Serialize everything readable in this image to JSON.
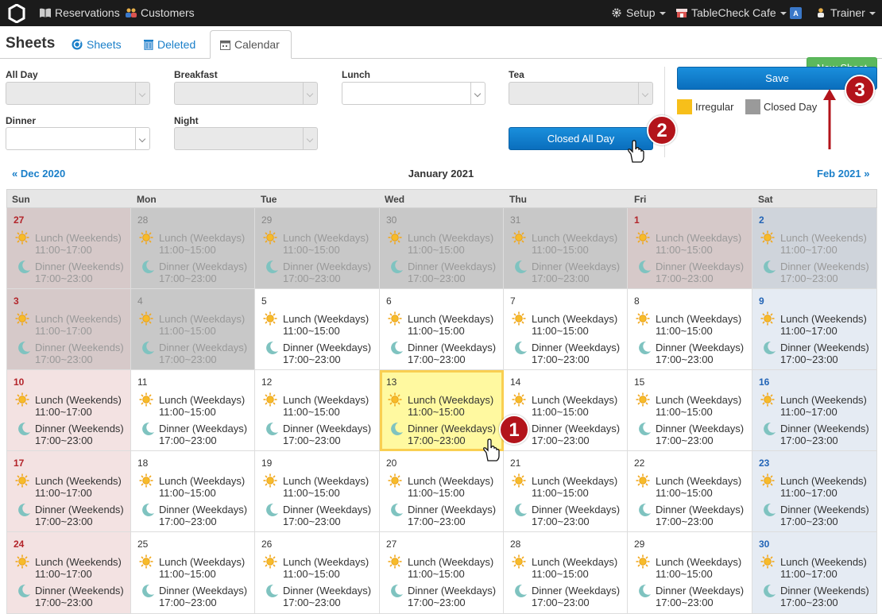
{
  "topnav": {
    "reservations": "Reservations",
    "customers": "Customers",
    "setup": "Setup",
    "store": "TableCheck Cafe",
    "language_icon": "language-icon",
    "user": "Trainer"
  },
  "subnav": {
    "title": "Sheets",
    "tabs": [
      "Sheets",
      "Deleted",
      "Calendar"
    ],
    "active_tab": "Calendar",
    "new_sheet": "New Sheet"
  },
  "filters": {
    "all_day": "All Day",
    "breakfast": "Breakfast",
    "lunch": "Lunch",
    "tea": "Tea",
    "dinner": "Dinner",
    "night": "Night"
  },
  "buttons": {
    "closed_all_day": "Closed All Day",
    "save": "Save"
  },
  "legend": {
    "irregular": "Irregular",
    "closed_day": "Closed Day"
  },
  "colors": {
    "irregular": "#f7bf1a",
    "closed_day": "#9a9a9a",
    "accent": "#1a7fc9",
    "badge": "#b3141b",
    "selected": "#fff9a0"
  },
  "badges": [
    "1",
    "2",
    "3"
  ],
  "calendar": {
    "prev": "« Dec 2020",
    "month": "January 2021",
    "next": "Feb 2021 »",
    "weekdays": [
      "Sun",
      "Mon",
      "Tue",
      "Wed",
      "Thu",
      "Fri",
      "Sat"
    ],
    "selected_day": "13",
    "weeks": [
      [
        {
          "day": "27",
          "closed": true,
          "lunch": "Lunch (Weekends)",
          "lunch_time": "11:00~17:00",
          "dinner": "Dinner (Weekends)",
          "dinner_time": "17:00~23:00"
        },
        {
          "day": "28",
          "closed": true,
          "lunch": "Lunch (Weekdays)",
          "lunch_time": "11:00~15:00",
          "dinner": "Dinner (Weekdays)",
          "dinner_time": "17:00~23:00"
        },
        {
          "day": "29",
          "closed": true,
          "lunch": "Lunch (Weekdays)",
          "lunch_time": "11:00~15:00",
          "dinner": "Dinner (Weekdays)",
          "dinner_time": "17:00~23:00"
        },
        {
          "day": "30",
          "closed": true,
          "lunch": "Lunch (Weekdays)",
          "lunch_time": "11:00~15:00",
          "dinner": "Dinner (Weekdays)",
          "dinner_time": "17:00~23:00"
        },
        {
          "day": "31",
          "closed": true,
          "lunch": "Lunch (Weekdays)",
          "lunch_time": "11:00~15:00",
          "dinner": "Dinner (Weekdays)",
          "dinner_time": "17:00~23:00"
        },
        {
          "day": "1",
          "closed": true,
          "lunch": "Lunch (Weekdays)",
          "lunch_time": "11:00~15:00",
          "dinner": "Dinner (Weekdays)",
          "dinner_time": "17:00~23:00"
        },
        {
          "day": "2",
          "closed": true,
          "lunch": "Lunch (Weekends)",
          "lunch_time": "11:00~17:00",
          "dinner": "Dinner (Weekends)",
          "dinner_time": "17:00~23:00"
        }
      ],
      [
        {
          "day": "3",
          "closed": true,
          "lunch": "Lunch (Weekends)",
          "lunch_time": "11:00~17:00",
          "dinner": "Dinner (Weekends)",
          "dinner_time": "17:00~23:00"
        },
        {
          "day": "4",
          "closed": true,
          "lunch": "Lunch (Weekdays)",
          "lunch_time": "11:00~15:00",
          "dinner": "Dinner (Weekdays)",
          "dinner_time": "17:00~23:00"
        },
        {
          "day": "5",
          "closed": false,
          "lunch": "Lunch (Weekdays)",
          "lunch_time": "11:00~15:00",
          "dinner": "Dinner (Weekdays)",
          "dinner_time": "17:00~23:00"
        },
        {
          "day": "6",
          "closed": false,
          "lunch": "Lunch (Weekdays)",
          "lunch_time": "11:00~15:00",
          "dinner": "Dinner (Weekdays)",
          "dinner_time": "17:00~23:00"
        },
        {
          "day": "7",
          "closed": false,
          "lunch": "Lunch (Weekdays)",
          "lunch_time": "11:00~15:00",
          "dinner": "Dinner (Weekdays)",
          "dinner_time": "17:00~23:00"
        },
        {
          "day": "8",
          "closed": false,
          "lunch": "Lunch (Weekdays)",
          "lunch_time": "11:00~15:00",
          "dinner": "Dinner (Weekdays)",
          "dinner_time": "17:00~23:00"
        },
        {
          "day": "9",
          "closed": false,
          "lunch": "Lunch (Weekends)",
          "lunch_time": "11:00~17:00",
          "dinner": "Dinner (Weekends)",
          "dinner_time": "17:00~23:00"
        }
      ],
      [
        {
          "day": "10",
          "closed": false,
          "lunch": "Lunch (Weekends)",
          "lunch_time": "11:00~17:00",
          "dinner": "Dinner (Weekends)",
          "dinner_time": "17:00~23:00"
        },
        {
          "day": "11",
          "closed": false,
          "lunch": "Lunch (Weekdays)",
          "lunch_time": "11:00~15:00",
          "dinner": "Dinner (Weekdays)",
          "dinner_time": "17:00~23:00"
        },
        {
          "day": "12",
          "closed": false,
          "lunch": "Lunch (Weekdays)",
          "lunch_time": "11:00~15:00",
          "dinner": "Dinner (Weekdays)",
          "dinner_time": "17:00~23:00"
        },
        {
          "day": "13",
          "closed": false,
          "lunch": "Lunch (Weekdays)",
          "lunch_time": "11:00~15:00",
          "dinner": "Dinner (Weekdays)",
          "dinner_time": "17:00~23:00"
        },
        {
          "day": "14",
          "closed": false,
          "lunch": "Lunch (Weekdays)",
          "lunch_time": "11:00~15:00",
          "dinner": "Dinner (Weekdays)",
          "dinner_time": "17:00~23:00"
        },
        {
          "day": "15",
          "closed": false,
          "lunch": "Lunch (Weekdays)",
          "lunch_time": "11:00~15:00",
          "dinner": "Dinner (Weekdays)",
          "dinner_time": "17:00~23:00"
        },
        {
          "day": "16",
          "closed": false,
          "lunch": "Lunch (Weekends)",
          "lunch_time": "11:00~17:00",
          "dinner": "Dinner (Weekends)",
          "dinner_time": "17:00~23:00"
        }
      ],
      [
        {
          "day": "17",
          "closed": false,
          "lunch": "Lunch (Weekends)",
          "lunch_time": "11:00~17:00",
          "dinner": "Dinner (Weekends)",
          "dinner_time": "17:00~23:00"
        },
        {
          "day": "18",
          "closed": false,
          "lunch": "Lunch (Weekdays)",
          "lunch_time": "11:00~15:00",
          "dinner": "Dinner (Weekdays)",
          "dinner_time": "17:00~23:00"
        },
        {
          "day": "19",
          "closed": false,
          "lunch": "Lunch (Weekdays)",
          "lunch_time": "11:00~15:00",
          "dinner": "Dinner (Weekdays)",
          "dinner_time": "17:00~23:00"
        },
        {
          "day": "20",
          "closed": false,
          "lunch": "Lunch (Weekdays)",
          "lunch_time": "11:00~15:00",
          "dinner": "Dinner (Weekdays)",
          "dinner_time": "17:00~23:00"
        },
        {
          "day": "21",
          "closed": false,
          "lunch": "Lunch (Weekdays)",
          "lunch_time": "11:00~15:00",
          "dinner": "Dinner (Weekdays)",
          "dinner_time": "17:00~23:00"
        },
        {
          "day": "22",
          "closed": false,
          "lunch": "Lunch (Weekdays)",
          "lunch_time": "11:00~15:00",
          "dinner": "Dinner (Weekdays)",
          "dinner_time": "17:00~23:00"
        },
        {
          "day": "23",
          "closed": false,
          "lunch": "Lunch (Weekends)",
          "lunch_time": "11:00~17:00",
          "dinner": "Dinner (Weekends)",
          "dinner_time": "17:00~23:00"
        }
      ],
      [
        {
          "day": "24",
          "closed": false,
          "lunch": "Lunch (Weekends)",
          "lunch_time": "11:00~17:00",
          "dinner": "Dinner (Weekends)",
          "dinner_time": "17:00~23:00"
        },
        {
          "day": "25",
          "closed": false,
          "lunch": "Lunch (Weekdays)",
          "lunch_time": "11:00~15:00",
          "dinner": "Dinner (Weekdays)",
          "dinner_time": "17:00~23:00"
        },
        {
          "day": "26",
          "closed": false,
          "lunch": "Lunch (Weekdays)",
          "lunch_time": "11:00~15:00",
          "dinner": "Dinner (Weekdays)",
          "dinner_time": "17:00~23:00"
        },
        {
          "day": "27",
          "closed": false,
          "lunch": "Lunch (Weekdays)",
          "lunch_time": "11:00~15:00",
          "dinner": "Dinner (Weekdays)",
          "dinner_time": "17:00~23:00"
        },
        {
          "day": "28",
          "closed": false,
          "lunch": "Lunch (Weekdays)",
          "lunch_time": "11:00~15:00",
          "dinner": "Dinner (Weekdays)",
          "dinner_time": "17:00~23:00"
        },
        {
          "day": "29",
          "closed": false,
          "lunch": "Lunch (Weekdays)",
          "lunch_time": "11:00~15:00",
          "dinner": "Dinner (Weekdays)",
          "dinner_time": "17:00~23:00"
        },
        {
          "day": "30",
          "closed": false,
          "lunch": "Lunch (Weekends)",
          "lunch_time": "11:00~17:00",
          "dinner": "Dinner (Weekends)",
          "dinner_time": "17:00~23:00"
        }
      ]
    ]
  }
}
